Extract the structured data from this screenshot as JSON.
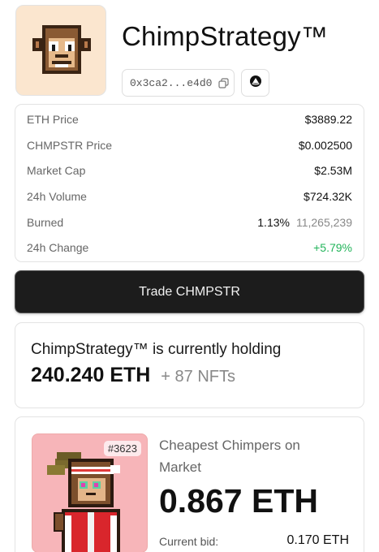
{
  "header": {
    "title": "ChimpStrategy™",
    "address": "0x3ca2...e4d0"
  },
  "stats": [
    {
      "label": "ETH Price",
      "value": "$3889.22"
    },
    {
      "label": "CHMPSTR Price",
      "value": "$0.002500"
    },
    {
      "label": "Market Cap",
      "value": "$2.53M"
    },
    {
      "label": "24h Volume",
      "value": "$724.32K"
    },
    {
      "label": "Burned",
      "value": "1.13%",
      "extra": "11,265,239"
    },
    {
      "label": "24h Change",
      "value": "+5.79%"
    }
  ],
  "trade": {
    "label": "Trade CHMPSTR"
  },
  "holding": {
    "line": "ChimpStrategy™ is currently holding",
    "amount": "240.240 ETH",
    "nfts": "+ 87 NFTs"
  },
  "market": {
    "tag": "#3623",
    "heading": "Cheapest Chimpers on Market",
    "price": "0.867 ETH",
    "bid_label": "Current bid:",
    "bid_value": "0.170 ETH"
  },
  "colors": {
    "positive": "#22b45a",
    "button_bg": "#1c1c1c",
    "avatar_bg": "#fbe6cf",
    "nft_bg": "#f7b5b9"
  },
  "icons": [
    "chimp-logo",
    "copy-icon",
    "link-icon"
  ]
}
